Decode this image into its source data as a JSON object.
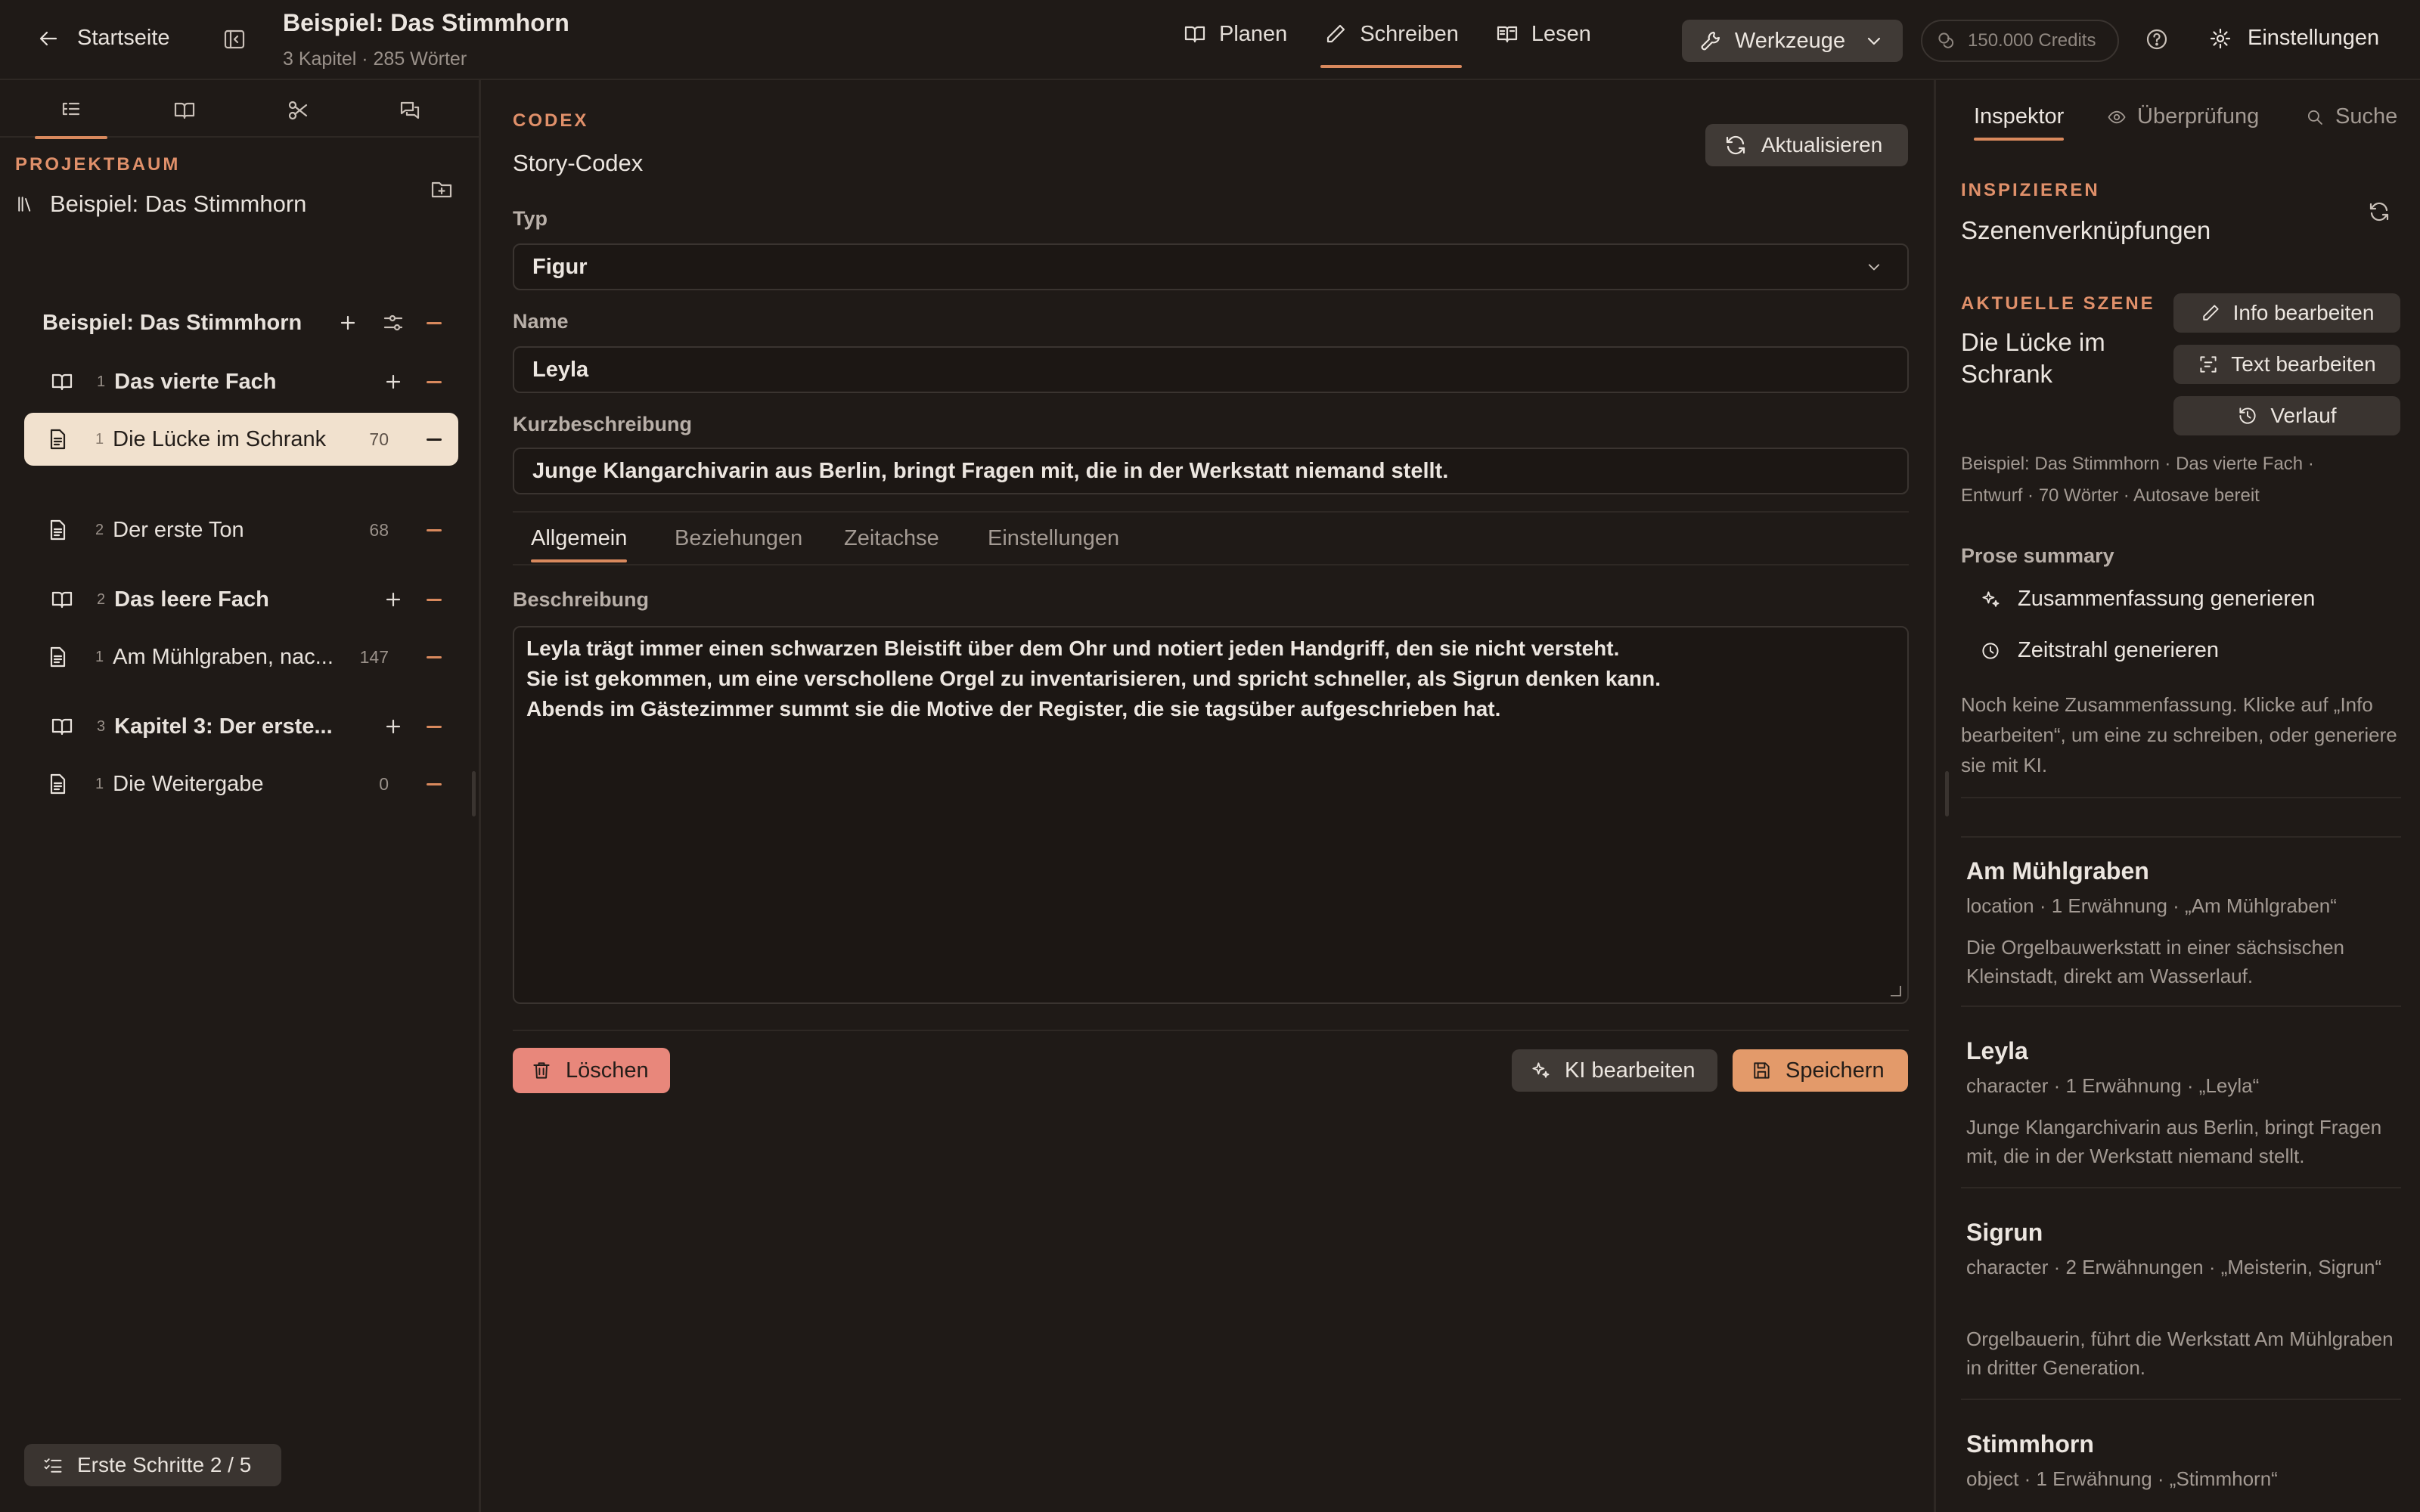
{
  "header": {
    "back_label": "Startseite",
    "project_title": "Beispiel: Das Stimmhorn",
    "project_stats": "3 Kapitel · 285 Wörter",
    "nav": {
      "plan": "Planen",
      "write": "Schreiben",
      "read": "Lesen"
    },
    "tools_label": "Werkzeuge",
    "credits": "150.000 Credits",
    "settings_label": "Einstellungen"
  },
  "sidebar": {
    "section_label": "PROJEKTBAUM",
    "project_name": "Beispiel: Das Stimmhorn",
    "root_label": "Beispiel: Das Stimmhorn",
    "chapters": [
      {
        "num": "1",
        "title": "Das vierte Fach",
        "scenes": [
          {
            "num": "1",
            "title": "Die Lücke im Schrank",
            "words": "70"
          },
          {
            "num": "2",
            "title": "Der erste Ton",
            "words": "68"
          }
        ]
      },
      {
        "num": "2",
        "title": "Das leere Fach",
        "scenes": [
          {
            "num": "1",
            "title": "Am Mühlgraben, nac...",
            "words": "147"
          }
        ]
      },
      {
        "num": "3",
        "title": "Kapitel 3: Der erste...",
        "scenes": [
          {
            "num": "1",
            "title": "Die Weitergabe",
            "words": "0"
          }
        ]
      }
    ],
    "onboarding_label": "Erste Schritte 2 / 5"
  },
  "codex": {
    "section_label": "CODEX",
    "title": "Story-Codex",
    "refresh_label": "Aktualisieren",
    "type_label": "Typ",
    "type_value": "Figur",
    "name_label": "Name",
    "name_value": "Leyla",
    "short_label": "Kurzbeschreibung",
    "short_value": "Junge Klangarchivarin aus Berlin, bringt Fragen mit, die in der Werkstatt niemand stellt.",
    "tabs": {
      "general": "Allgemein",
      "relations": "Beziehungen",
      "timeline": "Zeitachse",
      "settings": "Einstellungen"
    },
    "desc_label": "Beschreibung",
    "desc_lines": [
      "Leyla trägt immer einen schwarzen Bleistift über dem Ohr und notiert jeden Handgriff, den sie nicht versteht.",
      "Sie ist gekommen, um eine verschollene Orgel zu inventarisieren, und spricht schneller, als Sigrun denken kann.",
      "Abends im Gästezimmer summt sie die Motive der Register, die sie tagsüber aufgeschrieben hat."
    ],
    "delete_label": "Löschen",
    "ai_label": "KI bearbeiten",
    "save_label": "Speichern"
  },
  "inspector": {
    "tabs": {
      "inspector": "Inspektor",
      "review": "Überprüfung",
      "search": "Suche"
    },
    "section_label": "INSPIZIEREN",
    "heading": "Szenenverknüpfungen",
    "current_label": "AKTUELLE SZENE",
    "current_line1": "Die Lücke im",
    "current_line2": "Schrank",
    "btn_info": "Info bearbeiten",
    "btn_text": "Text bearbeiten",
    "btn_history": "Verlauf",
    "meta_line1": "Beispiel: Das Stimmhorn  ·  Das vierte Fach  ·",
    "meta_line2": "Entwurf  ·  70 Wörter  ·  Autosave bereit",
    "prose_label": "Prose summary",
    "gen_summary": "Zusammenfassung generieren",
    "gen_timeline": "Zeitstrahl generieren",
    "note": "Noch keine Zusammenfassung. Klicke auf „Info bearbeiten“, um eine zu schreiben, oder generiere sie mit KI.",
    "entries": [
      {
        "title": "Am Mühlgraben",
        "meta": "location · 1 Erwähnung · „Am Mühlgraben“",
        "desc": "Die Orgelbauwerkstatt in einer sächsischen Kleinstadt, direkt am Wasserlauf."
      },
      {
        "title": "Leyla",
        "meta": "character · 1 Erwähnung · „Leyla“",
        "desc": "Junge Klangarchivarin aus Berlin, bringt Fragen mit, die in der Werkstatt niemand stellt."
      },
      {
        "title": "Sigrun",
        "meta": "character · 2 Erwähnungen · „Meisterin, Sigrun“",
        "desc": "Orgelbauerin, führt die Werkstatt Am Mühlgraben in dritter Generation."
      },
      {
        "title": "Stimmhorn",
        "meta": "object · 1 Erwähnung · „Stimmhorn“",
        "desc": ""
      }
    ]
  }
}
